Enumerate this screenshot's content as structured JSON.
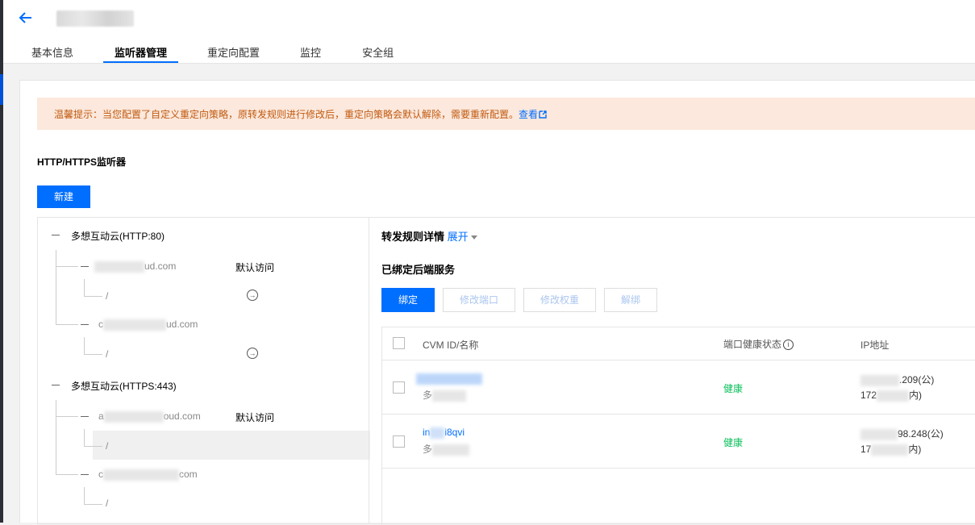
{
  "header": {
    "tabs": [
      {
        "label": "基本信息"
      },
      {
        "label": "监听器管理"
      },
      {
        "label": "重定向配置"
      },
      {
        "label": "监控"
      },
      {
        "label": "安全组"
      }
    ]
  },
  "notice": {
    "text": "温馨提示：当您配置了自定义重定向策略，原转发规则进行修改后，重定向策略会默认解除，需要重新配置。",
    "link": "查看"
  },
  "section_title": "HTTP/HTTPS监听器",
  "new_button": "新建",
  "tree": {
    "listener1": "多想互动云(HTTP:80)",
    "l1_domain1_suffix": "ud.com",
    "l1_domain1_badge": "默认访问",
    "l1_path1": "/",
    "l1_domain2_prefix": "c",
    "l1_domain2_suffix": "ud.com",
    "l1_path2": "/",
    "listener2": "多想互动云(HTTPS:443)",
    "l2_domain1_prefix": "a",
    "l2_domain1_suffix": "oud.com",
    "l2_domain1_badge": "默认访问",
    "l2_path1": "/",
    "l2_domain2_prefix": "c",
    "l2_domain2_suffix": "com",
    "l2_path2": "/"
  },
  "right": {
    "title": "转发规则详情",
    "expand": "展开",
    "subtitle": "已绑定后端服务",
    "buttons": {
      "bind": "绑定",
      "edit_port": "修改端口",
      "edit_weight": "修改权重",
      "unbind": "解绑"
    },
    "columns": {
      "id": "CVM ID/名称",
      "health": "端口健康状态",
      "ip": "IP地址"
    },
    "rows": [
      {
        "id": "",
        "name": "多",
        "health": "健康",
        "ip_pub": ".209(公)",
        "ip_priv_prefix": "172",
        "ip_priv_suffix": "内)"
      },
      {
        "id_prefix": "in",
        "id_suffix": "i8qvi",
        "name": "多",
        "health": "健康",
        "ip_pub": "98.248(公)",
        "ip_priv_prefix": "17",
        "ip_priv_suffix": "内)"
      }
    ]
  }
}
